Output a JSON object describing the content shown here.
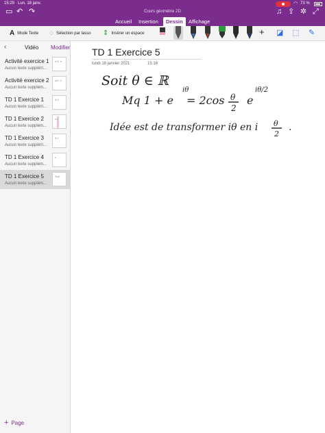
{
  "status": {
    "time": "15:29",
    "date": "Lun. 18 janv.",
    "battery": "73 %"
  },
  "app": {
    "document_title": "Cours géométrie 2D"
  },
  "ribbon": {
    "tabs": [
      {
        "label": "Accueil"
      },
      {
        "label": "Insertion"
      },
      {
        "label": "Dessin"
      },
      {
        "label": "Affichage"
      }
    ],
    "active_tab": "Dessin"
  },
  "toolbar": {
    "text_mode": "Mode Texte",
    "lasso": "Sélection par lasso",
    "insert_space": "Insérer un espace",
    "pens": [
      {
        "color": "#555555"
      },
      {
        "color": "#3a7bd5"
      },
      {
        "color": "#c0392b"
      },
      {
        "color": "#2e9c3a"
      },
      {
        "color": "#2a2a2a"
      },
      {
        "color": "#1e3a8a"
      }
    ]
  },
  "sidebar": {
    "back_icon": "chevron-left-icon",
    "section_title": "Vidéo",
    "edit_label": "Modifier",
    "pages": [
      {
        "title": "Activité exercice 1",
        "subtitle": "Aucun texte supplém...",
        "thumb": "n+1 e"
      },
      {
        "title": "Activité exercice 2",
        "subtitle": "Aucun texte supplém...",
        "thumb": "z2+ 2"
      },
      {
        "title": "TD 1 Exercice 1",
        "subtitle": "Aucun texte supplém...",
        "thumb": "3 4"
      },
      {
        "title": "TD 1 Exercice 2",
        "subtitle": "Aucun texte supplém...",
        "thumb": "z="
      },
      {
        "title": "TD 1 Exercice 3",
        "subtitle": "Aucun texte supplém...",
        "thumb": "3 z"
      },
      {
        "title": "TD 1 Exercice 4",
        "subtitle": "Aucun texte supplém...",
        "thumb": "z"
      },
      {
        "title": "TD 1 Exercice 5",
        "subtitle": "Aucun texte supplém...",
        "thumb": "Soit"
      }
    ],
    "active_index": 6,
    "add_page": "Page"
  },
  "page": {
    "title": "TD 1 Exercice 5",
    "date": "lundi 18 janvier 2021",
    "time": "15:16",
    "ink": {
      "line1": "Soit θ ∈ ℝ",
      "line2a": "Mq  1 + e",
      "line2b": "iθ",
      "line2c": "= 2cos",
      "line2d": "θ",
      "line2e": "2",
      "line2f": "e",
      "line2g": "iθ/2",
      "line3a": "Idée  est de transformer iθ en i",
      "line3b": "θ",
      "line3c": "2",
      "line3d": "."
    }
  }
}
